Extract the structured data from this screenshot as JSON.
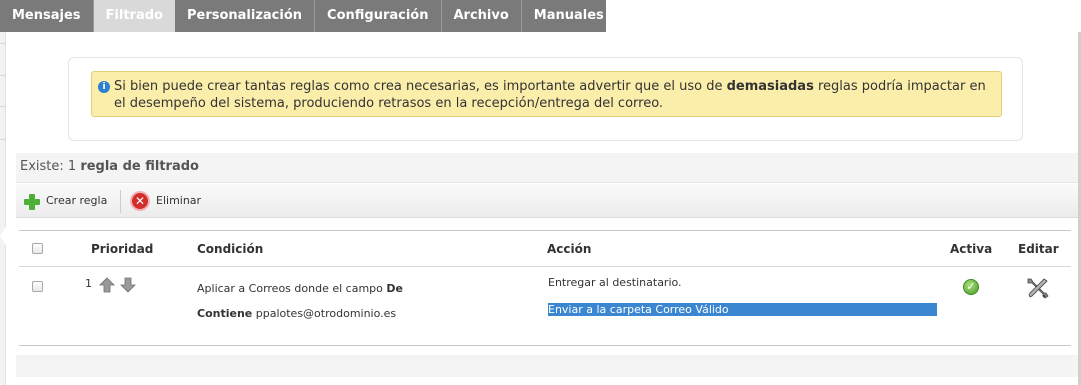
{
  "tabs": [
    {
      "label": "Mensajes",
      "active": false
    },
    {
      "label": "Filtrado",
      "active": true
    },
    {
      "label": "Personalización",
      "active": false
    },
    {
      "label": "Configuración",
      "active": false
    },
    {
      "label": "Archivo",
      "active": false
    },
    {
      "label": "Manuales",
      "active": false
    }
  ],
  "notice": {
    "text_before": "Si bien puede crear tantas reglas como crea necesarias, es importante advertir que el uso de ",
    "text_bold": "demasiadas",
    "text_after": " reglas podría impactar en el desempeño del sistema, produciendo retrasos en la recepción/entrega del correo.",
    "icon": "info-icon"
  },
  "summary": {
    "prefix": "Existe: 1 ",
    "bold": "regla de filtrado"
  },
  "toolbar": {
    "create_label": "Crear regla",
    "delete_label": "Eliminar"
  },
  "table": {
    "headers": {
      "priority": "Prioridad",
      "condition": "Condición",
      "action": "Acción",
      "active": "Activa",
      "edit": "Editar"
    },
    "rows": [
      {
        "priority": "1",
        "condition_prefix": "Aplicar a Correos donde el campo ",
        "condition_field": "De",
        "condition_operator": "Contiene",
        "condition_value": " ppalotes@otrodominio.es",
        "action_1": "Entregar al destinatario.",
        "action_2": "Enviar a la carpeta Correo Válido",
        "active": true
      }
    ]
  },
  "colors": {
    "tab_bar": "#7a7a7a",
    "tab_active": "#d9d9d9",
    "notice_bg": "#fbeeab",
    "selection": "#3b86d1"
  }
}
